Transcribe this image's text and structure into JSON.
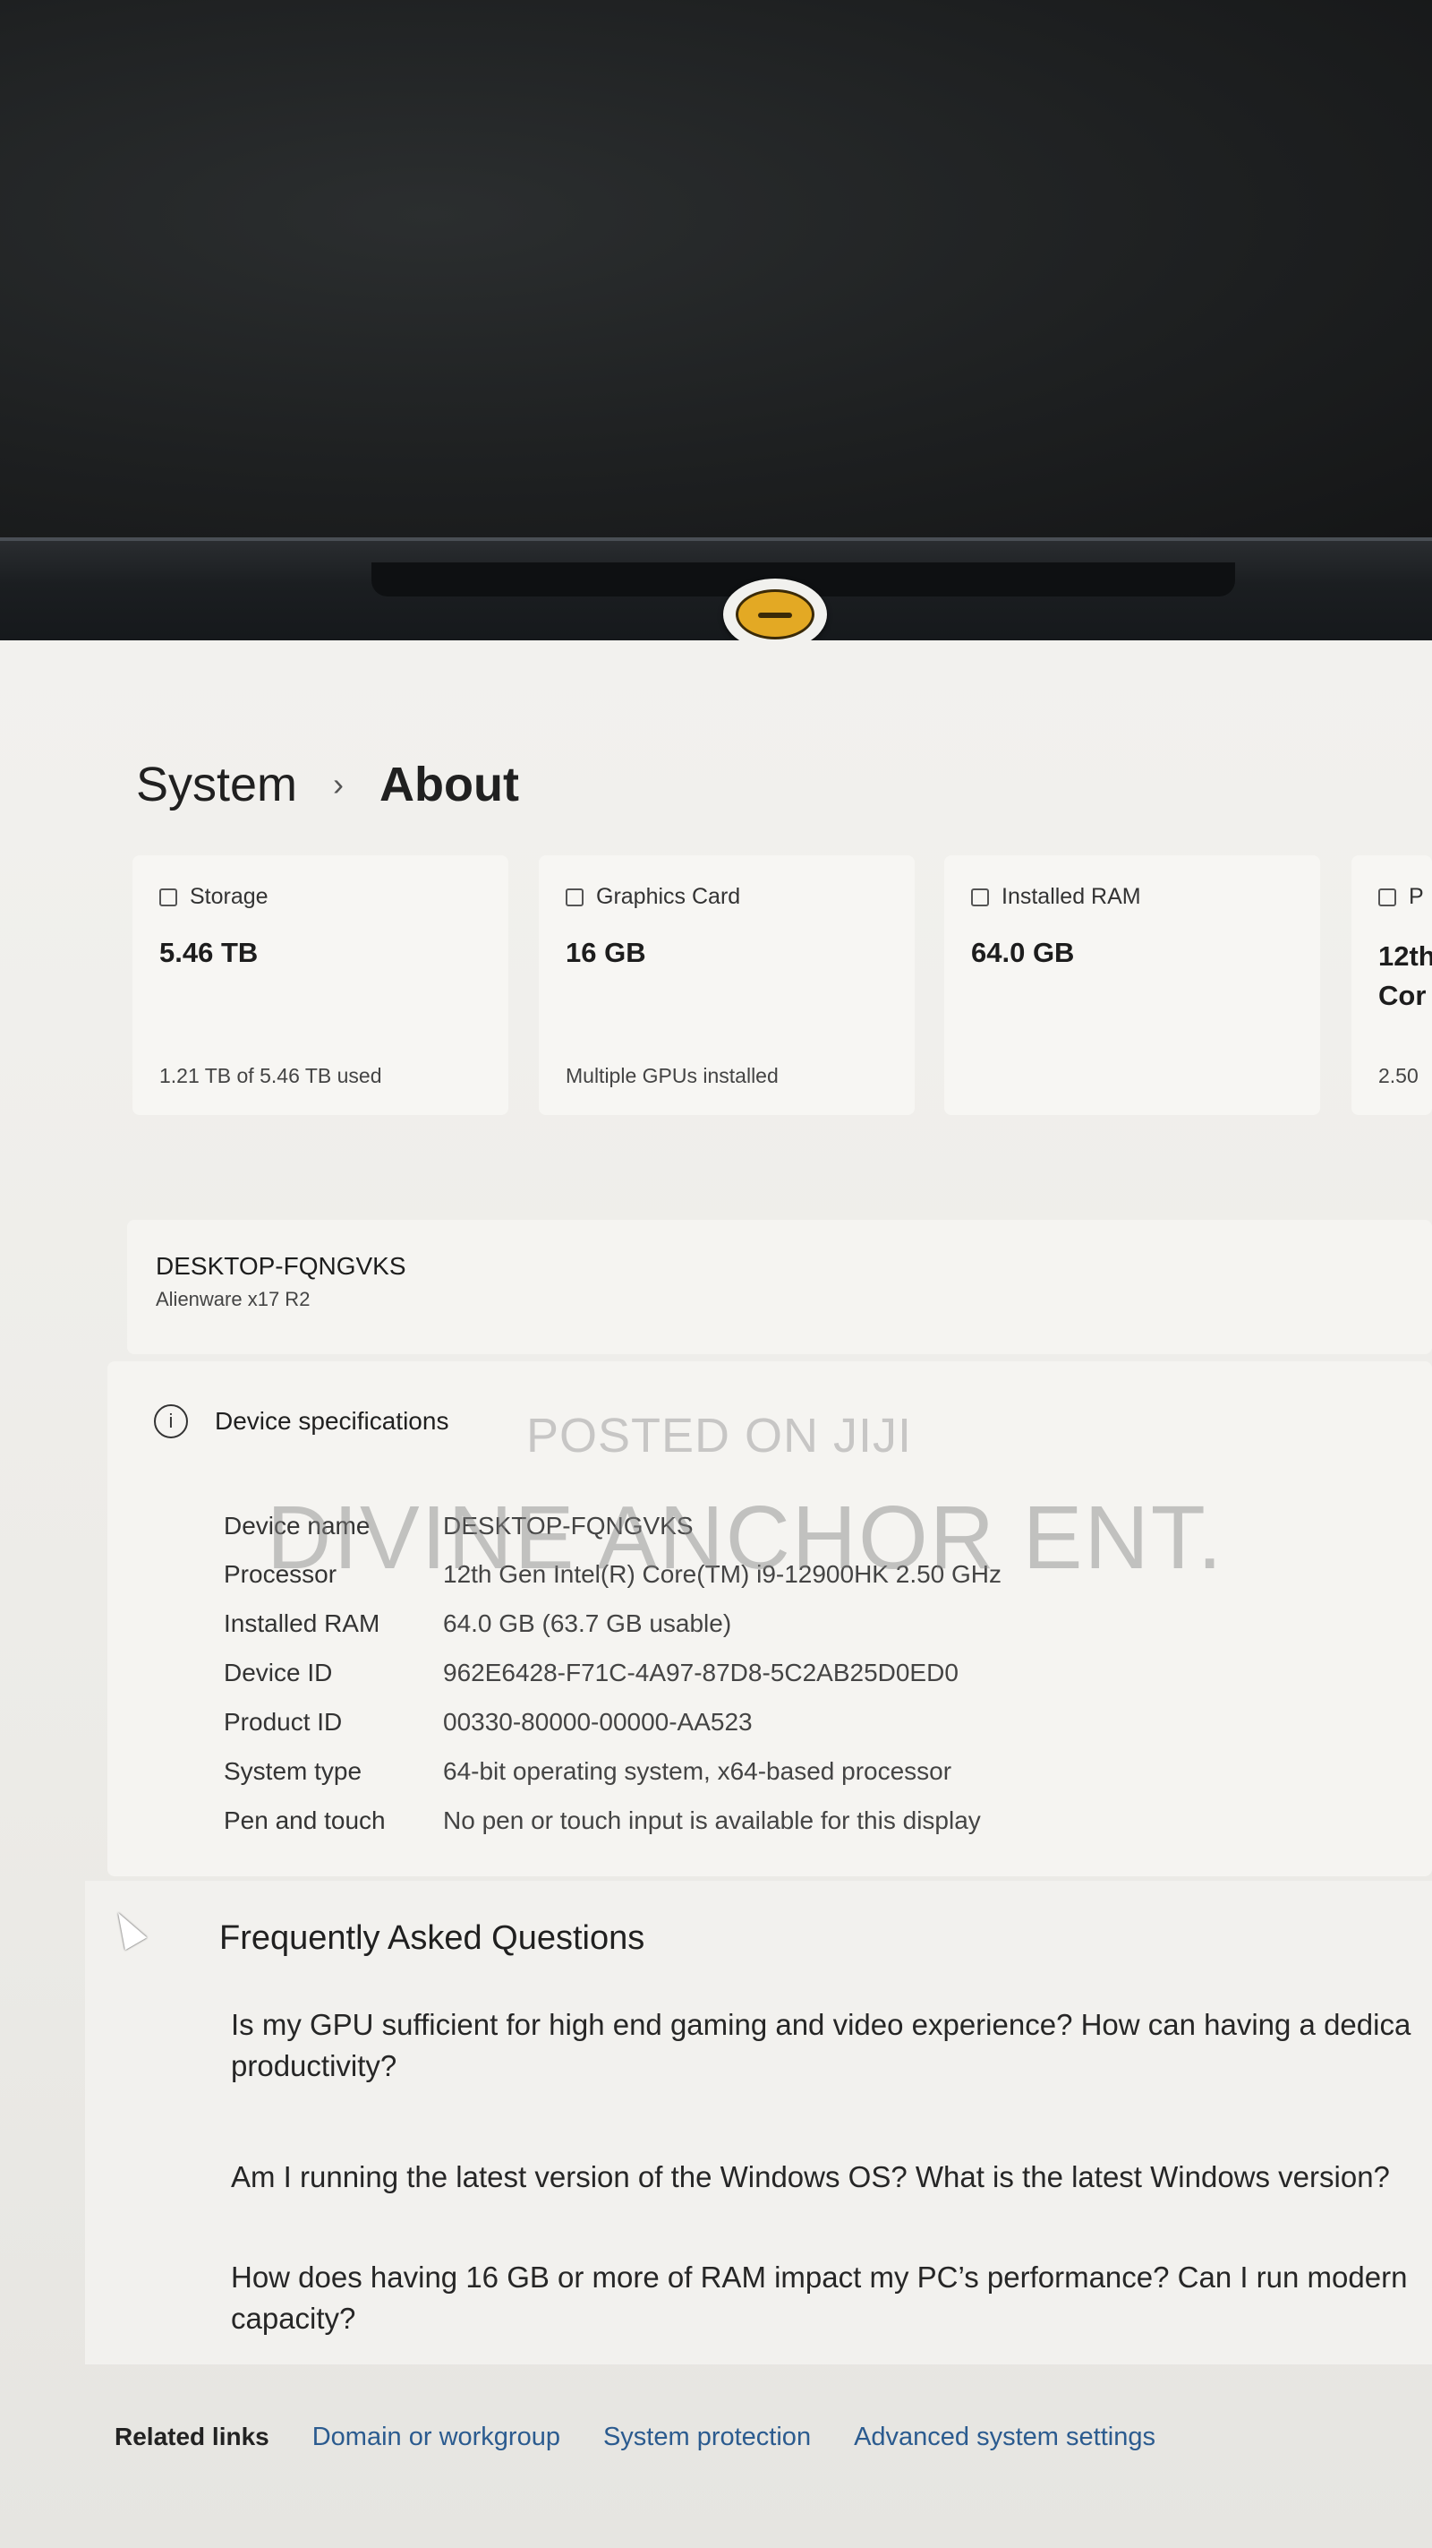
{
  "breadcrumb": {
    "parent": "System",
    "separator": "›",
    "current": "About"
  },
  "cards": [
    {
      "label": "Storage",
      "value": "5.46 TB",
      "sub": "1.21 TB of 5.46 TB used",
      "icon": "storage-icon"
    },
    {
      "label": "Graphics Card",
      "value": "16 GB",
      "sub": "Multiple GPUs installed",
      "icon": "gpu-icon"
    },
    {
      "label": "Installed RAM",
      "value": "64.0 GB",
      "sub": "",
      "icon": "ram-icon"
    },
    {
      "label": "P",
      "value": "12th",
      "value2": "Cor",
      "sub": "2.50",
      "icon": "processor-icon"
    }
  ],
  "device": {
    "name": "DESKTOP-FQNGVKS",
    "model": "Alienware x17 R2"
  },
  "specs": {
    "title": "Device specifications",
    "rows": [
      {
        "key": "Device name",
        "value": "DESKTOP-FQNGVKS"
      },
      {
        "key": "Processor",
        "value": "12th Gen Intel(R) Core(TM) i9-12900HK   2.50 GHz"
      },
      {
        "key": "Installed RAM",
        "value": "64.0 GB (63.7 GB usable)"
      },
      {
        "key": "Device ID",
        "value": "962E6428-F71C-4A97-87D8-5C2AB25D0ED0"
      },
      {
        "key": "Product ID",
        "value": "00330-80000-00000-AA523"
      },
      {
        "key": "System type",
        "value": "64-bit operating system, x64-based processor"
      },
      {
        "key": "Pen and touch",
        "value": "No pen or touch input is available for this display"
      }
    ]
  },
  "watermark": {
    "line1": "POSTED ON JIJI",
    "line2": "DIVINE ANCHOR ENT."
  },
  "faq": {
    "title": "Frequently Asked Questions",
    "questions": [
      "Is my GPU sufficient for high end gaming and video experience? How can having a dedica productivity?",
      "Am I running the latest version of the Windows OS? What is the latest Windows version?",
      "How does having 16 GB or more of RAM impact my PC’s performance? Can I run modern capacity?"
    ]
  },
  "related": {
    "label": "Related links",
    "links": [
      "Domain or workgroup",
      "System protection",
      "Advanced system settings"
    ]
  }
}
